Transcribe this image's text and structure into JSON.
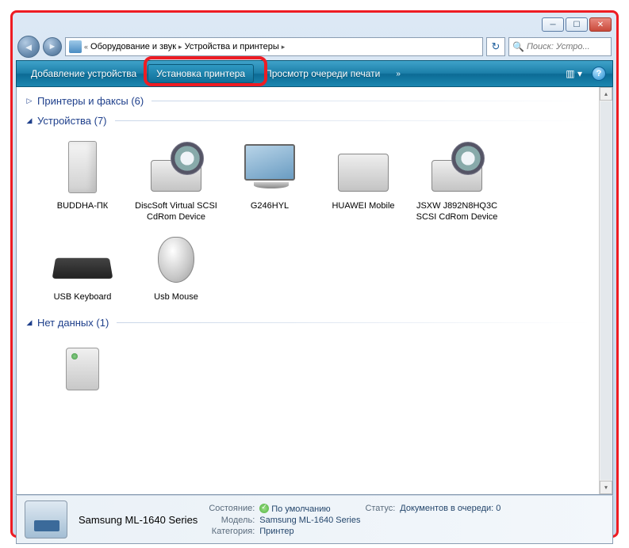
{
  "window_buttons": {
    "min": "─",
    "max": "☐",
    "close": "✕"
  },
  "breadcrumb": {
    "drop_sep": "«",
    "items": [
      "Оборудование и звук",
      "Устройства и принтеры"
    ],
    "sep": "▸"
  },
  "search": {
    "placeholder": "Поиск: Устро..."
  },
  "refresh_icon": "↻",
  "toolbar": {
    "add_device": "Добавление устройства",
    "install_printer": "Установка принтера",
    "view_queue": "Просмотр очереди печати",
    "chevron": "»",
    "view_icon": "▥ ▾",
    "help": "?"
  },
  "groups": {
    "printers": {
      "title": "Принтеры и факсы (6)",
      "expanded": false
    },
    "devices": {
      "title": "Устройства (7)",
      "expanded": true,
      "items": [
        {
          "name": "BUDDHA-ПК",
          "icon": "pc"
        },
        {
          "name": "DiscSoft Virtual SCSI CdRom Device",
          "icon": "drive"
        },
        {
          "name": "G246HYL",
          "icon": "monitor"
        },
        {
          "name": "HUAWEI Mobile",
          "icon": "drive-nodisc"
        },
        {
          "name": "JSXW J892N8HQ3C SCSI CdRom Device",
          "icon": "drive"
        },
        {
          "name": "USB Keyboard",
          "icon": "keyboard"
        },
        {
          "name": "Usb Mouse",
          "icon": "mouse"
        }
      ]
    },
    "nodata": {
      "title": "Нет данных (1)",
      "expanded": true,
      "items": [
        {
          "name": "",
          "icon": "printer-sm"
        }
      ]
    }
  },
  "details": {
    "title": "Samsung ML-1640 Series",
    "state_k": "Состояние:",
    "state_v": "По умолчанию",
    "model_k": "Модель:",
    "model_v": "Samsung ML-1640 Series",
    "cat_k": "Категория:",
    "cat_v": "Принтер",
    "status_k": "Статус:",
    "status_v": "Документов в очереди: 0"
  }
}
